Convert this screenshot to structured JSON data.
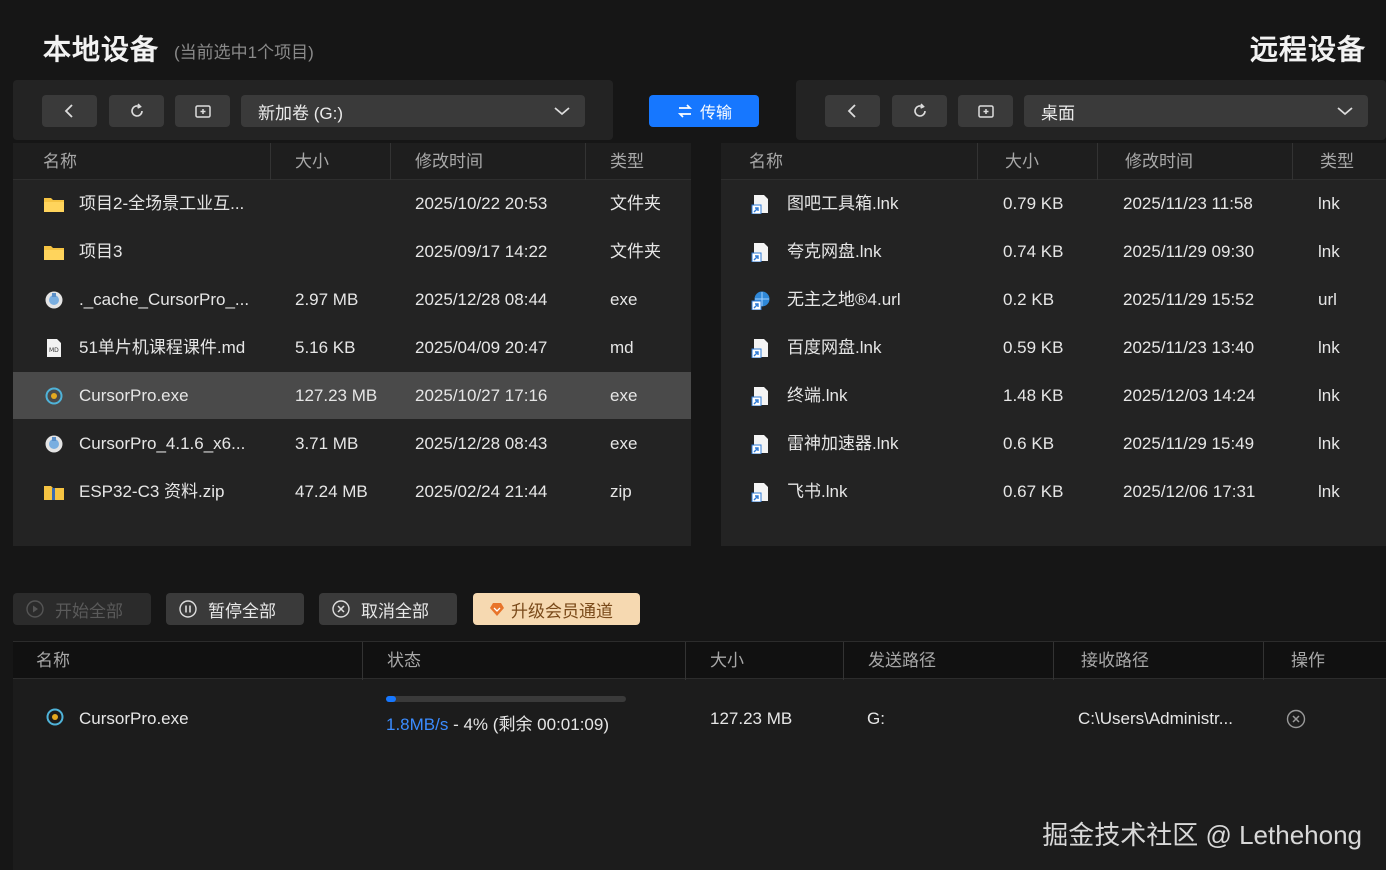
{
  "local": {
    "title": "本地设备",
    "subtitle": "(当前选中1个项目)",
    "path": "新加卷 (G:)"
  },
  "remote": {
    "title": "远程设备",
    "path": "桌面"
  },
  "transfer_button": "传输",
  "columns": {
    "name": "名称",
    "size": "大小",
    "modified": "修改时间",
    "type": "类型"
  },
  "local_files": [
    {
      "icon": "folder-icon",
      "name": "项目2-全场景工业互...",
      "size": "",
      "modified": "2025/10/22 20:53",
      "type": "文件夹",
      "selected": false
    },
    {
      "icon": "folder-icon",
      "name": "项目3",
      "size": "",
      "modified": "2025/09/17 14:22",
      "type": "文件夹",
      "selected": false
    },
    {
      "icon": "installer-icon",
      "name": "._cache_CursorPro_...",
      "size": "2.97 MB",
      "modified": "2025/12/28 08:44",
      "type": "exe",
      "selected": false
    },
    {
      "icon": "markdown-file-icon",
      "name": "51单片机课程课件.md",
      "size": "5.16 KB",
      "modified": "2025/04/09 20:47",
      "type": "md",
      "selected": false
    },
    {
      "icon": "app-exe-icon",
      "name": "CursorPro.exe",
      "size": "127.23 MB",
      "modified": "2025/10/27 17:16",
      "type": "exe",
      "selected": true
    },
    {
      "icon": "installer-icon",
      "name": "CursorPro_4.1.6_x6...",
      "size": "3.71 MB",
      "modified": "2025/12/28 08:43",
      "type": "exe",
      "selected": false
    },
    {
      "icon": "zip-folder-icon",
      "name": "ESP32-C3 资料.zip",
      "size": "47.24 MB",
      "modified": "2025/02/24 21:44",
      "type": "zip",
      "selected": false
    }
  ],
  "remote_files": [
    {
      "icon": "shortcut-icon",
      "name": "图吧工具箱.lnk",
      "size": "0.79 KB",
      "modified": "2025/11/23 11:58",
      "type": "lnk"
    },
    {
      "icon": "shortcut-icon",
      "name": "夸克网盘.lnk",
      "size": "0.74 KB",
      "modified": "2025/11/29 09:30",
      "type": "lnk"
    },
    {
      "icon": "url-globe-icon",
      "name": "无主之地®4.url",
      "size": "0.2 KB",
      "modified": "2025/11/29 15:52",
      "type": "url"
    },
    {
      "icon": "shortcut-icon",
      "name": "百度网盘.lnk",
      "size": "0.59 KB",
      "modified": "2025/11/23 13:40",
      "type": "lnk"
    },
    {
      "icon": "shortcut-icon",
      "name": "终端.lnk",
      "size": "1.48 KB",
      "modified": "2025/12/03 14:24",
      "type": "lnk"
    },
    {
      "icon": "shortcut-icon",
      "name": "雷神加速器.lnk",
      "size": "0.6 KB",
      "modified": "2025/11/29 15:49",
      "type": "lnk"
    },
    {
      "icon": "shortcut-icon",
      "name": "飞书.lnk",
      "size": "0.67 KB",
      "modified": "2025/12/06 17:31",
      "type": "lnk"
    }
  ],
  "controls": {
    "start_all": "开始全部",
    "pause_all": "暂停全部",
    "cancel_all": "取消全部",
    "vip": "升级会员通道"
  },
  "transfer_columns": {
    "name": "名称",
    "status": "状态",
    "size": "大小",
    "send_path": "发送路径",
    "receive_path": "接收路径",
    "action": "操作"
  },
  "transfers": [
    {
      "name": "CursorPro.exe",
      "speed": "1.8MB/s",
      "separator": " - ",
      "percent_text": "4%",
      "remaining": "(剩余 00:01:09)",
      "progress": 0.04,
      "size": "127.23 MB",
      "send_path": "G:",
      "receive_path": "C:\\Users\\Administr..."
    }
  ],
  "watermark": "掘金技术社区 @ Lethehong",
  "colors": {
    "accent": "#1677ff",
    "selected_row": "#4a4a4a",
    "vip_bg": "#f6d9b1"
  }
}
